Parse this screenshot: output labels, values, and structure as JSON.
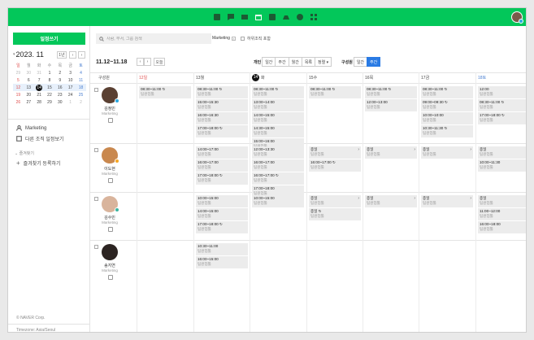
{
  "sidebar": {
    "write_label": "일정쓰기",
    "calendar_title": "2023. 11",
    "today_btn": "1년",
    "weekdays": [
      "일",
      "월",
      "화",
      "수",
      "목",
      "금",
      "토"
    ],
    "weeks": [
      [
        "29",
        "30",
        "31",
        "1",
        "2",
        "3",
        "4"
      ],
      [
        "5",
        "6",
        "7",
        "8",
        "9",
        "10",
        "11"
      ],
      [
        "12",
        "13",
        "14",
        "15",
        "16",
        "17",
        "18"
      ],
      [
        "19",
        "20",
        "21",
        "22",
        "23",
        "24",
        "25"
      ],
      [
        "26",
        "27",
        "28",
        "29",
        "30",
        "1",
        "2"
      ]
    ],
    "org_name": "Marketing",
    "org_view": "다른 조직 일정보기",
    "fav_title": "즐겨찾기",
    "fav_add": "즐겨찾기 등록하기",
    "copyright": "© NAVER Corp.",
    "timezone": "Timezone: Asia/Seoul"
  },
  "toolbar": {
    "search_placeholder": "사람, 부서, 그룹 검색",
    "filter_tag": "Marketing",
    "include_sub": "하위조직 포함",
    "range": "11.12~11.18",
    "today": "오늘",
    "view_label": "개인",
    "views": [
      "일간",
      "주간",
      "월간",
      "목록",
      "정렬 ▾"
    ],
    "org_view_label": "구성원",
    "org_views": [
      "일간",
      "주간"
    ]
  },
  "columns": {
    "member_header": "구성원",
    "days": [
      {
        "num": "12",
        "dow": "일",
        "kind": "sun"
      },
      {
        "num": "13",
        "dow": "월",
        "kind": ""
      },
      {
        "num": "14",
        "dow": "화",
        "kind": "today"
      },
      {
        "num": "15",
        "dow": "수",
        "kind": ""
      },
      {
        "num": "16",
        "dow": "목",
        "kind": ""
      },
      {
        "num": "17",
        "dow": "금",
        "kind": ""
      },
      {
        "num": "18",
        "dow": "토",
        "kind": "sat"
      }
    ]
  },
  "members": [
    {
      "name": "김정민",
      "dept": "Marketing",
      "avatar_color": "#5a4032",
      "badge_color": "#2aa8e0"
    },
    {
      "name": "이도현",
      "dept": "Marketing",
      "avatar_color": "#c9884e",
      "badge_color": "#f5a623"
    },
    {
      "name": "김수민",
      "dept": "Marketing",
      "avatar_color": "#d9b49c",
      "badge_color": "#3ab5a0"
    },
    {
      "name": "송지연",
      "dept": "Marketing",
      "avatar_color": "#2c2422",
      "badge_color": ""
    }
  ],
  "events": [
    {
      "row": 0,
      "col": 0,
      "slot": 0,
      "time": "08:30~11:00 ↻",
      "sub": "팀원업툴"
    },
    {
      "row": 0,
      "col": 1,
      "slot": 0,
      "time": "08:30~11:00 ↻",
      "sub": "팀원업툴"
    },
    {
      "row": 0,
      "col": 1,
      "slot": 1,
      "time": "15:00~15:30",
      "sub": "팀원업툴"
    },
    {
      "row": 0,
      "col": 1,
      "slot": 2,
      "time": "16:00~16:30",
      "sub": "팀원업툴"
    },
    {
      "row": 0,
      "col": 1,
      "slot": 3,
      "time": "17:00~18:00 ↻",
      "sub": "팀원업툴"
    },
    {
      "row": 0,
      "col": 2,
      "slot": 0,
      "time": "08:30~11:00 ↻",
      "sub": "팀원업툴"
    },
    {
      "row": 0,
      "col": 2,
      "slot": 1,
      "time": "13:00~14:00",
      "sub": "팀원업툴"
    },
    {
      "row": 0,
      "col": 2,
      "slot": 2,
      "time": "14:00~15:00",
      "sub": "팀원업툴"
    },
    {
      "row": 0,
      "col": 2,
      "slot": 3,
      "time": "14:30~15:00",
      "sub": "팀원업툴"
    },
    {
      "row": 0,
      "col": 2,
      "slot": 4,
      "time": "15:00~16:00",
      "sub": "팀원업툴"
    },
    {
      "row": 0,
      "col": 3,
      "slot": 0,
      "time": "08:30~11:00 ↻",
      "sub": "팀원업툴"
    },
    {
      "row": 0,
      "col": 4,
      "slot": 0,
      "time": "08:30~11:00 ↻",
      "sub": "팀원업툴"
    },
    {
      "row": 0,
      "col": 4,
      "slot": 1,
      "time": "12:00~13:00",
      "sub": "팀원업툴"
    },
    {
      "row": 0,
      "col": 5,
      "slot": 0,
      "time": "08:30~11:00 ↻",
      "sub": "팀원업툴"
    },
    {
      "row": 0,
      "col": 5,
      "slot": 1,
      "time": "09:00~09:30 ↻",
      "sub": "팀원업툴"
    },
    {
      "row": 0,
      "col": 5,
      "slot": 2,
      "time": "10:00~10:00",
      "sub": "팀원업툴"
    },
    {
      "row": 0,
      "col": 5,
      "slot": 3,
      "time": "10:30~11:30 ↻",
      "sub": "팀원업툴"
    },
    {
      "row": 0,
      "col": 6,
      "slot": 0,
      "time": "12:00",
      "sub": "팀원업툴",
      "chev": "›"
    },
    {
      "row": 0,
      "col": 6,
      "slot": 1,
      "time": "08:30~11:00 ↻",
      "sub": "팀원업툴"
    },
    {
      "row": 0,
      "col": 6,
      "slot": 2,
      "time": "17:00~18:00 ↻",
      "sub": "팀원업툴"
    },
    {
      "row": 1,
      "col": 1,
      "slot": 0,
      "time": "14:00~17:00",
      "sub": "팀원업툴"
    },
    {
      "row": 1,
      "col": 1,
      "slot": 1,
      "time": "16:00~17:00",
      "sub": "팀원업툴"
    },
    {
      "row": 1,
      "col": 1,
      "slot": 2,
      "time": "17:00~18:00 ↻",
      "sub": "팀원업툴"
    },
    {
      "row": 1,
      "col": 2,
      "slot": 0,
      "time": "12:00~13:30",
      "sub": "팀원업툴"
    },
    {
      "row": 1,
      "col": 2,
      "slot": 1,
      "time": "16:00~17:00",
      "sub": "팀원업툴"
    },
    {
      "row": 1,
      "col": 2,
      "slot": 2,
      "time": "16:00~17:00 ↻",
      "sub": "팀원업툴"
    },
    {
      "row": 1,
      "col": 2,
      "slot": 3,
      "time": "17:00~18:00",
      "sub": "팀원업툴"
    },
    {
      "row": 1,
      "col": 3,
      "slot": 0,
      "time": "종일",
      "sub": "팀원업툴",
      "chev": "›"
    },
    {
      "row": 1,
      "col": 3,
      "slot": 1,
      "time": "16:00~17:00 ↻",
      "sub": "팀원업툴"
    },
    {
      "row": 1,
      "col": 4,
      "slot": 0,
      "time": "종일",
      "sub": "팀원업툴",
      "chev": "›"
    },
    {
      "row": 1,
      "col": 5,
      "slot": 0,
      "time": "종일",
      "sub": "팀원업툴",
      "chev": "›"
    },
    {
      "row": 1,
      "col": 6,
      "slot": 0,
      "time": "종일",
      "sub": "팀원업툴"
    },
    {
      "row": 1,
      "col": 6,
      "slot": 1,
      "time": "10:00~11:30",
      "sub": "팀원업툴"
    },
    {
      "row": 2,
      "col": 1,
      "slot": 0,
      "time": "10:00~15:00",
      "sub": "팀원업툴"
    },
    {
      "row": 2,
      "col": 1,
      "slot": 1,
      "time": "14:00~15:00",
      "sub": "팀원업툴"
    },
    {
      "row": 2,
      "col": 1,
      "slot": 2,
      "time": "17:00~18:00 ↻",
      "sub": "팀원업툴"
    },
    {
      "row": 2,
      "col": 2,
      "slot": 0,
      "time": "10:00~15:00",
      "sub": "팀원업툴"
    },
    {
      "row": 2,
      "col": 3,
      "slot": 0,
      "time": "종일",
      "sub": "팀원업툴",
      "chev": "›"
    },
    {
      "row": 2,
      "col": 3,
      "slot": 1,
      "time": "종일 ↻",
      "sub": "팀원업툴"
    },
    {
      "row": 2,
      "col": 4,
      "slot": 0,
      "time": "종일",
      "sub": "팀원업툴",
      "chev": "›"
    },
    {
      "row": 2,
      "col": 5,
      "slot": 0,
      "time": "종일",
      "sub": "팀원업툴",
      "chev": "›"
    },
    {
      "row": 2,
      "col": 6,
      "slot": 0,
      "time": "종일",
      "sub": "팀원업툴"
    },
    {
      "row": 2,
      "col": 6,
      "slot": 1,
      "time": "11:00~12:00",
      "sub": "팀원업툴"
    },
    {
      "row": 2,
      "col": 6,
      "slot": 2,
      "time": "16:00~18:00",
      "sub": "팀원업툴"
    },
    {
      "row": 3,
      "col": 1,
      "slot": 0,
      "time": "10:30~11:00",
      "sub": "팀원업툴"
    },
    {
      "row": 3,
      "col": 1,
      "slot": 1,
      "time": "16:00~15:00",
      "sub": "팀원업툴"
    }
  ]
}
